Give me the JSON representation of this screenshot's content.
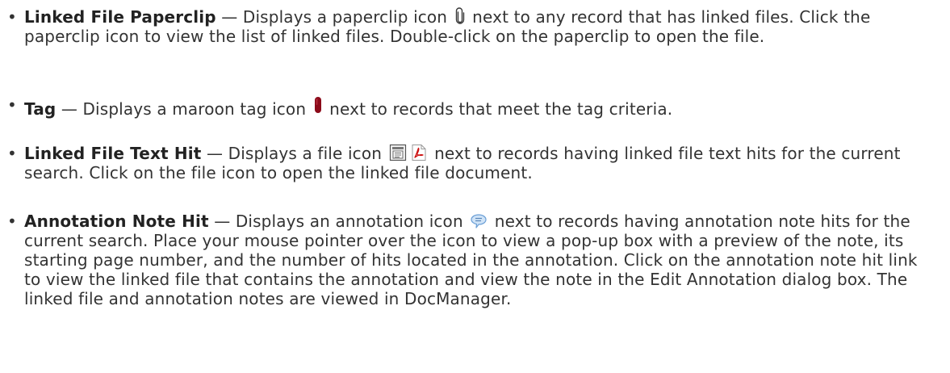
{
  "bullet_glyph": "•",
  "items": [
    {
      "term": "Linked File Paperclip",
      "before_icon": " — Displays a paperclip icon ",
      "icon": "paperclip-icon",
      "after_icon": " next to any record that has linked files. Click the paperclip icon to view the list of linked files. Double-click on the paperclip to open the file."
    },
    {
      "term": "Tag",
      "before_icon": " — Displays a maroon tag icon ",
      "icon": "maroon-tag-icon",
      "after_icon": " next to records that meet the tag criteria."
    },
    {
      "term": "Linked File Text Hit",
      "before_icon": " — Displays a file icon ",
      "icon": "file-icon",
      "icon2": "pdf-file-icon",
      "after_icon": " next to records having linked file text hits for the current search. Click on the file icon to open the linked file document."
    },
    {
      "term": "Annotation Note Hit",
      "before_icon": " — Displays an annotation icon ",
      "icon": "annotation-icon",
      "after_icon": " next to records having annotation note hits for the current search. Place your mouse pointer over the icon to view a pop-up box with a preview of the note, its starting page number, and the number of hits located in the annotation. Click on the annotation note hit link to view the linked file that contains the annotation and view the note in the Edit Annotation dialog box. The linked file and annotation notes are viewed in DocManager."
    }
  ],
  "colors": {
    "text": "#333333",
    "tag": "#8b0a1a",
    "pdf_red": "#cc1111"
  }
}
